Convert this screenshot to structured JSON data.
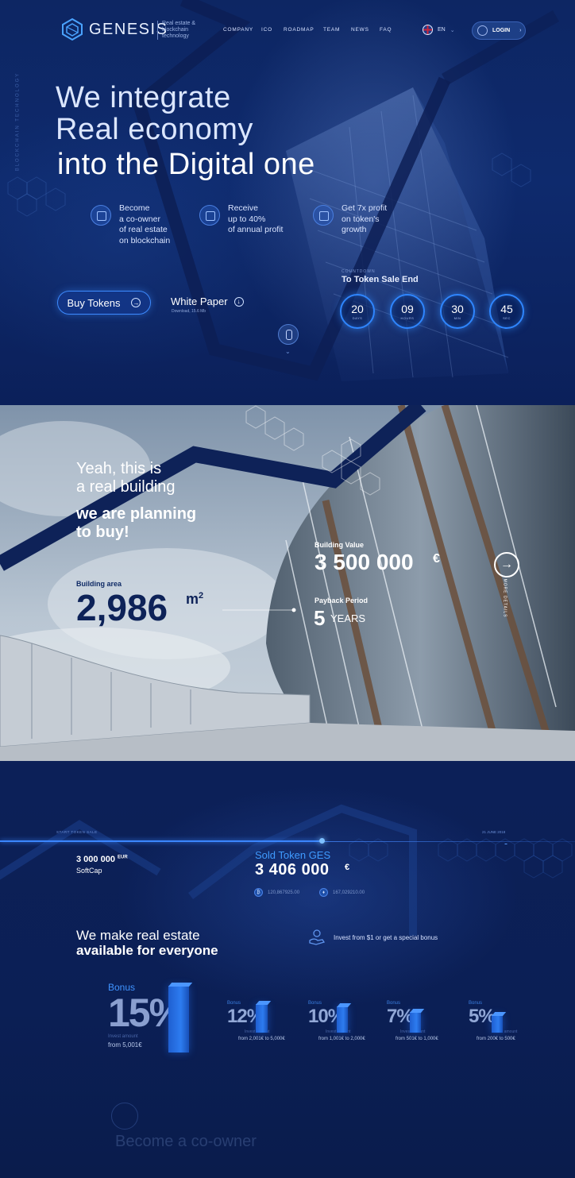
{
  "nav": {
    "brand": "GENESIS",
    "tagline": "Real estate & blockchain technology",
    "menu": [
      "COMPANY",
      "ICO",
      "ROADMAP",
      "TEAM",
      "NEWS",
      "FAQ"
    ],
    "lang": "EN",
    "login": "LOGIN"
  },
  "hero": {
    "side_text": "BLOCKCHAIN TECHNOLOGY",
    "line1": "We integrate",
    "line2": "Real economy",
    "line3": "into the Digital one",
    "features": [
      {
        "icon": "building-icon",
        "text": "Become\na co-owner\nof real estate\non blockchain"
      },
      {
        "icon": "bulb-icon",
        "text": "Receive\nup to 40%\nof annual profit"
      },
      {
        "icon": "atom-icon",
        "text": "Get 7x profit\non token's\ngrowth"
      }
    ],
    "buy_label": "Buy Tokens",
    "white_paper": "White Paper",
    "white_paper_sub": "Download, 15.6 Mb",
    "countdown_caption": "COUNTDOWN",
    "countdown_title": "To Token Sale End",
    "countdown": [
      {
        "value": "20",
        "unit": "DAYS"
      },
      {
        "value": "09",
        "unit": "HOURS"
      },
      {
        "value": "30",
        "unit": "MIN"
      },
      {
        "value": "45",
        "unit": "SEC"
      }
    ]
  },
  "building": {
    "line1": "Yeah, this is",
    "line2": "a real building",
    "line3": "we are planning",
    "line4": "to buy!",
    "area_label": "Building area",
    "area_value": "2,986",
    "area_unit": "m",
    "area_exp": "2",
    "value_label": "Building Value",
    "value": "3 500 000",
    "value_currency": "€",
    "payback_label": "Payback Period",
    "payback_num": "5",
    "payback_unit": "YEARS",
    "more_label": "MORE DETAILS"
  },
  "sale": {
    "start_label": "START TOKEN SALE",
    "end_date": "21 JUNE 2018",
    "progress": 0.56,
    "softcap_value": "3 000 000",
    "softcap_currency": "EUR",
    "softcap_label": "SoftCap",
    "sold_label": "Sold Token GES",
    "sold_value": "3 406 000",
    "sold_currency": "€",
    "btc": "120,867925.00",
    "eth": "167,029210.00",
    "headline1": "We make real estate",
    "headline2": "available for everyone",
    "invest_text": "Invest from $1 or get a special bonus",
    "bonuses": [
      {
        "label": "Bonus",
        "pct": "15%",
        "ia": "Invest amount",
        "range": "from 5,001€"
      },
      {
        "label": "Bonus",
        "pct": "12%",
        "ia": "Invest amount",
        "range": "from 2,001€  to 5,000€"
      },
      {
        "label": "Bonus",
        "pct": "10%",
        "ia": "Invest amount",
        "range": "from 1,001€  to 2,000€"
      },
      {
        "label": "Bonus",
        "pct": "7%",
        "ia": "Invest amount",
        "range": "from 501€  to 1,000€"
      },
      {
        "label": "Bonus",
        "pct": "5%",
        "ia": "Invest amount",
        "range": "from 200€  to 500€"
      }
    ],
    "ghost_heading": "Become a co-owner"
  },
  "colors": {
    "accent": "#2f86ff",
    "navy": "#0b1f55",
    "text_dark": "#0d2258"
  }
}
